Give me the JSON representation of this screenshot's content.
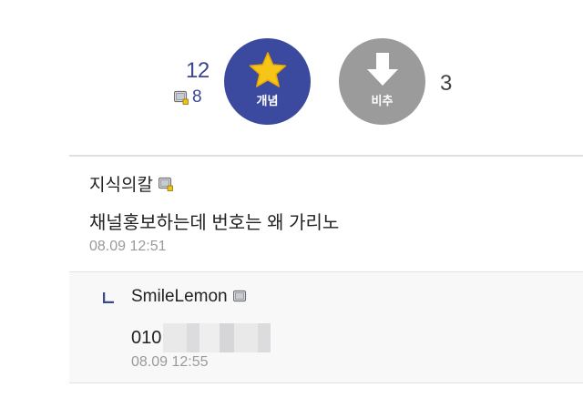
{
  "vote": {
    "up_count": "12",
    "fixed_count": "8",
    "up_label": "개념",
    "down_label": "비추",
    "down_count": "3",
    "up_color": "#3b4a9f",
    "down_color": "#9b9b9b",
    "star_color": "#f5c518"
  },
  "comments": [
    {
      "nick": "지식의칼",
      "text": "채널홍보하는데 번호는 왜 가리노",
      "date": "08.09 12:51"
    }
  ],
  "reply": {
    "nick": "SmileLemon",
    "text": "010",
    "date": "08.09 12:55"
  },
  "icons": {
    "fixed_nick": "fixed-nick-icon",
    "star": "star-icon",
    "down_arrow": "down-arrow-icon",
    "reply_arrow": "reply-arrow-icon"
  }
}
